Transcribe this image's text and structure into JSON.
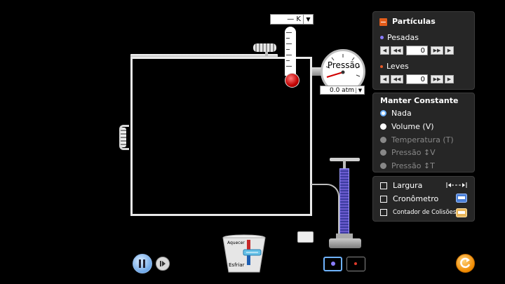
{
  "thermometer": {
    "readout": "— K"
  },
  "gauge": {
    "label": "Pressão",
    "readout": "0.0 atm"
  },
  "heater": {
    "top_label": "Aquecer",
    "bottom_label": "Esfriar"
  },
  "particles_panel": {
    "title": "Partículas",
    "heavy": {
      "label": "Pesadas",
      "value": "0",
      "color": "#8a7dff"
    },
    "light": {
      "label": "Leves",
      "value": "0",
      "color": "#e85a2a"
    }
  },
  "constant_panel": {
    "title": "Manter Constante",
    "options": [
      {
        "label": "Nada",
        "selected": true,
        "enabled": true
      },
      {
        "label": "Volume (V)",
        "selected": false,
        "enabled": true
      },
      {
        "label": "Temperatura (T)",
        "selected": false,
        "enabled": false
      },
      {
        "label": "Pressão ↕V",
        "selected": false,
        "enabled": false
      },
      {
        "label": "Pressão ↕T",
        "selected": false,
        "enabled": false
      }
    ]
  },
  "tools_panel": {
    "width": {
      "label": "Largura",
      "icon": "width-arrow-icon"
    },
    "stopwatch": {
      "label": "Cronômetro",
      "icon": "stopwatch-icon"
    },
    "collisions": {
      "label": "Contador de Colisões",
      "icon": "collision-counter-icon"
    }
  },
  "colors": {
    "accent": "#e35d1b",
    "selection": "#6fb3ff",
    "reset": "#f08a00"
  }
}
